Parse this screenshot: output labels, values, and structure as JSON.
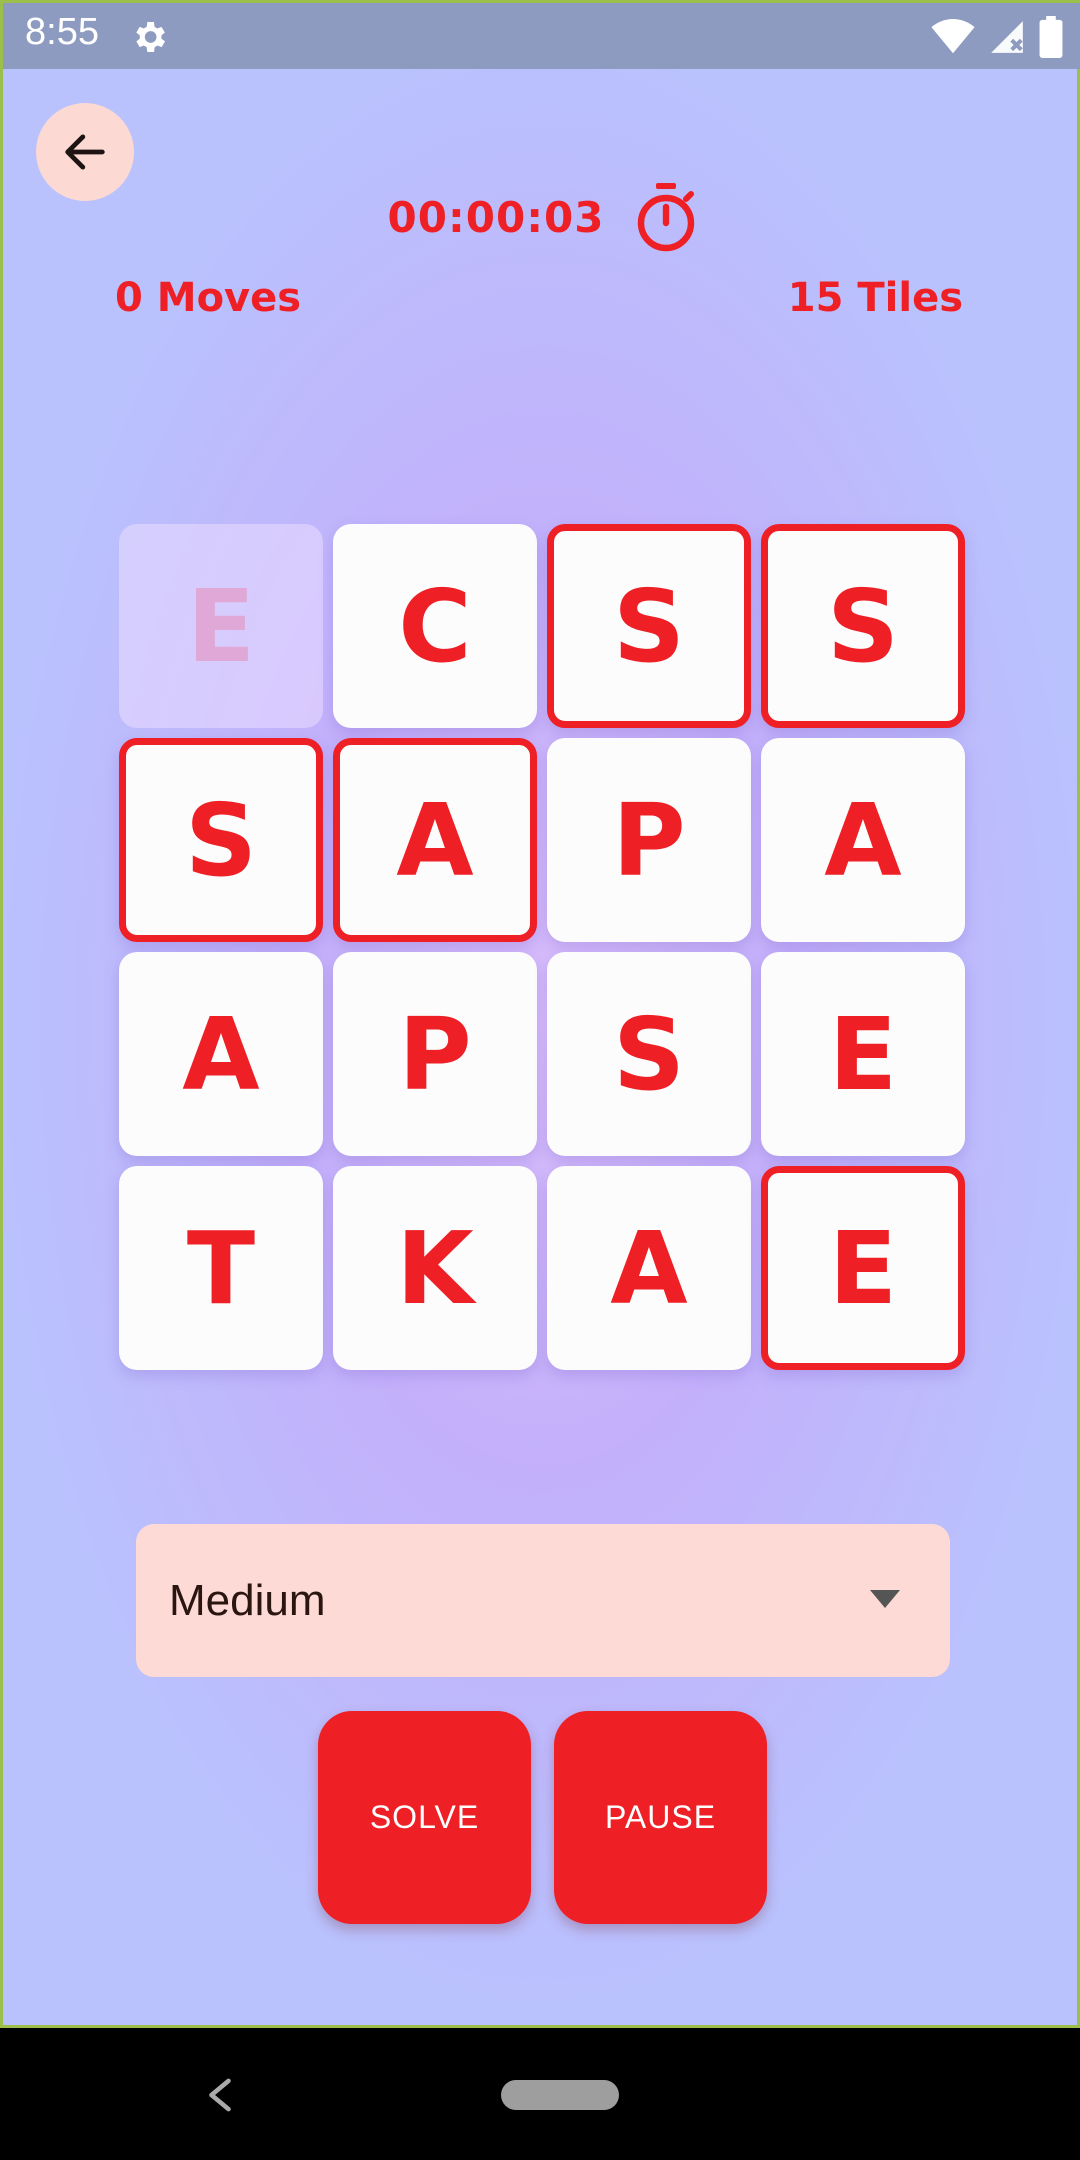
{
  "status_bar": {
    "time": "8:55",
    "icons": [
      "gear-icon",
      "wifi-icon",
      "signal-icon",
      "battery-icon"
    ]
  },
  "header": {
    "back_icon": "arrow-left-icon",
    "timer": "00:00:03",
    "timer_icon": "stopwatch-icon",
    "moves": "0 Moves",
    "tiles": "15 Tiles"
  },
  "board": {
    "rows": 4,
    "cols": 4,
    "tiles": [
      {
        "letter": "E",
        "state": "blank"
      },
      {
        "letter": "C",
        "state": "normal"
      },
      {
        "letter": "S",
        "state": "correct"
      },
      {
        "letter": "S",
        "state": "correct"
      },
      {
        "letter": "S",
        "state": "correct"
      },
      {
        "letter": "A",
        "state": "correct"
      },
      {
        "letter": "P",
        "state": "normal"
      },
      {
        "letter": "A",
        "state": "normal"
      },
      {
        "letter": "A",
        "state": "normal"
      },
      {
        "letter": "P",
        "state": "normal"
      },
      {
        "letter": "S",
        "state": "normal"
      },
      {
        "letter": "E",
        "state": "normal"
      },
      {
        "letter": "T",
        "state": "normal"
      },
      {
        "letter": "K",
        "state": "normal"
      },
      {
        "letter": "A",
        "state": "normal"
      },
      {
        "letter": "E",
        "state": "correct"
      }
    ]
  },
  "difficulty": {
    "selected": "Medium"
  },
  "actions": {
    "solve_label": "SOLVE",
    "pause_label": "PAUSE"
  },
  "colors": {
    "accent": "#ee2025",
    "tile_bg": "#fcfcfd",
    "select_bg": "#fddad5"
  }
}
